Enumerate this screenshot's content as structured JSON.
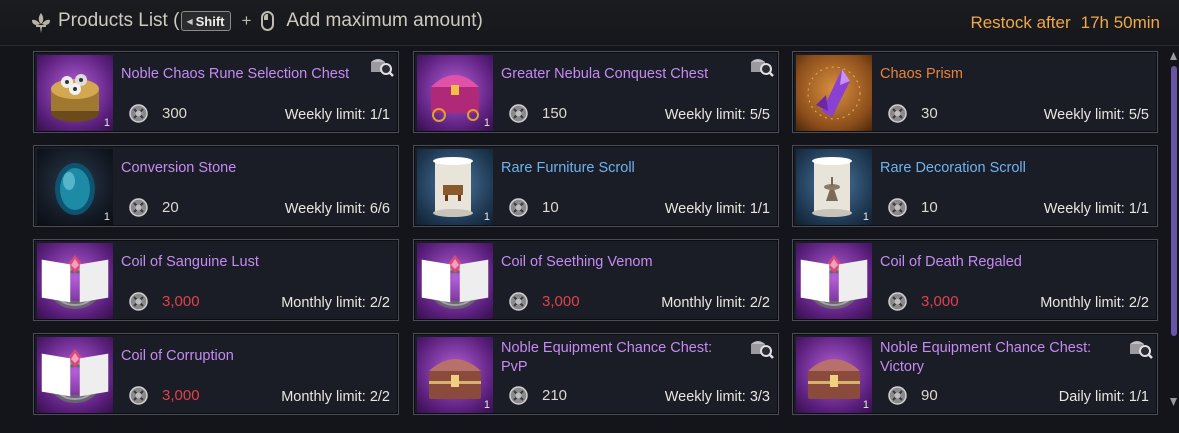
{
  "header": {
    "title": "Products List (",
    "shift_key": "Shift",
    "plus": "+",
    "hint": "Add maximum amount)",
    "restock_label": "Restock after",
    "restock_time": "17h 50min"
  },
  "colors": {
    "accent_orange": "#f0a848",
    "name_purple": "#c58bf2",
    "name_blue": "#6eb3f0",
    "name_orange": "#e8843a",
    "price_red": "#e0424a",
    "scroll_thumb": "#6a54a4"
  },
  "products": [
    {
      "name": "Noble Chaos Rune Selection Chest",
      "price": "300",
      "limit": "Weekly limit: 1/1",
      "qty": "1",
      "rarity": "purple",
      "icon": "rune-chest-icon",
      "inspect": true
    },
    {
      "name": "Greater Nebula Conquest Chest",
      "price": "150",
      "limit": "Weekly limit: 5/5",
      "qty": "1",
      "rarity": "purple",
      "icon": "nebula-chest-icon",
      "inspect": true
    },
    {
      "name": "Chaos Prism",
      "price": "30",
      "limit": "Weekly limit: 5/5",
      "qty": "",
      "rarity": "orange",
      "icon": "chaos-prism-icon",
      "inspect": false
    },
    {
      "name": "Conversion Stone",
      "price": "20",
      "limit": "Weekly limit: 6/6",
      "qty": "1",
      "rarity": "dark",
      "icon": "conversion-stone-icon",
      "inspect": false
    },
    {
      "name": "Rare Furniture Scroll",
      "price": "10",
      "limit": "Weekly limit: 1/1",
      "qty": "1",
      "rarity": "blue",
      "icon": "furniture-scroll-icon",
      "inspect": false
    },
    {
      "name": "Rare Decoration Scroll",
      "price": "10",
      "limit": "Weekly limit: 1/1",
      "qty": "1",
      "rarity": "blue",
      "icon": "decoration-scroll-icon",
      "inspect": false
    },
    {
      "name": "Coil of Sanguine Lust",
      "price": "3,000",
      "limit": "Monthly limit: 2/2",
      "qty": "",
      "rarity": "purple",
      "icon": "ring-icon",
      "inspect": false,
      "book": true
    },
    {
      "name": "Coil of Seething Venom",
      "price": "3,000",
      "limit": "Monthly limit: 2/2",
      "qty": "",
      "rarity": "purple",
      "icon": "ring-icon",
      "inspect": false,
      "book": true
    },
    {
      "name": "Coil of Death Regaled",
      "price": "3,000",
      "limit": "Monthly limit: 2/2",
      "qty": "",
      "rarity": "purple",
      "icon": "ring-icon",
      "inspect": false,
      "book": true
    },
    {
      "name": "Coil of Corruption",
      "price": "3,000",
      "limit": "Monthly limit: 2/2",
      "qty": "",
      "rarity": "purple",
      "icon": "ring-icon",
      "inspect": false,
      "book": true
    },
    {
      "name": "Noble Equipment Chance Chest: PvP",
      "price": "210",
      "limit": "Weekly limit: 3/3",
      "qty": "1",
      "rarity": "purple",
      "icon": "equipment-chest-icon",
      "inspect": true
    },
    {
      "name": "Noble Equipment Chance Chest: Victory",
      "price": "90",
      "limit": "Daily limit: 1/1",
      "qty": "1",
      "rarity": "purple",
      "icon": "equipment-chest-icon",
      "inspect": true
    }
  ]
}
